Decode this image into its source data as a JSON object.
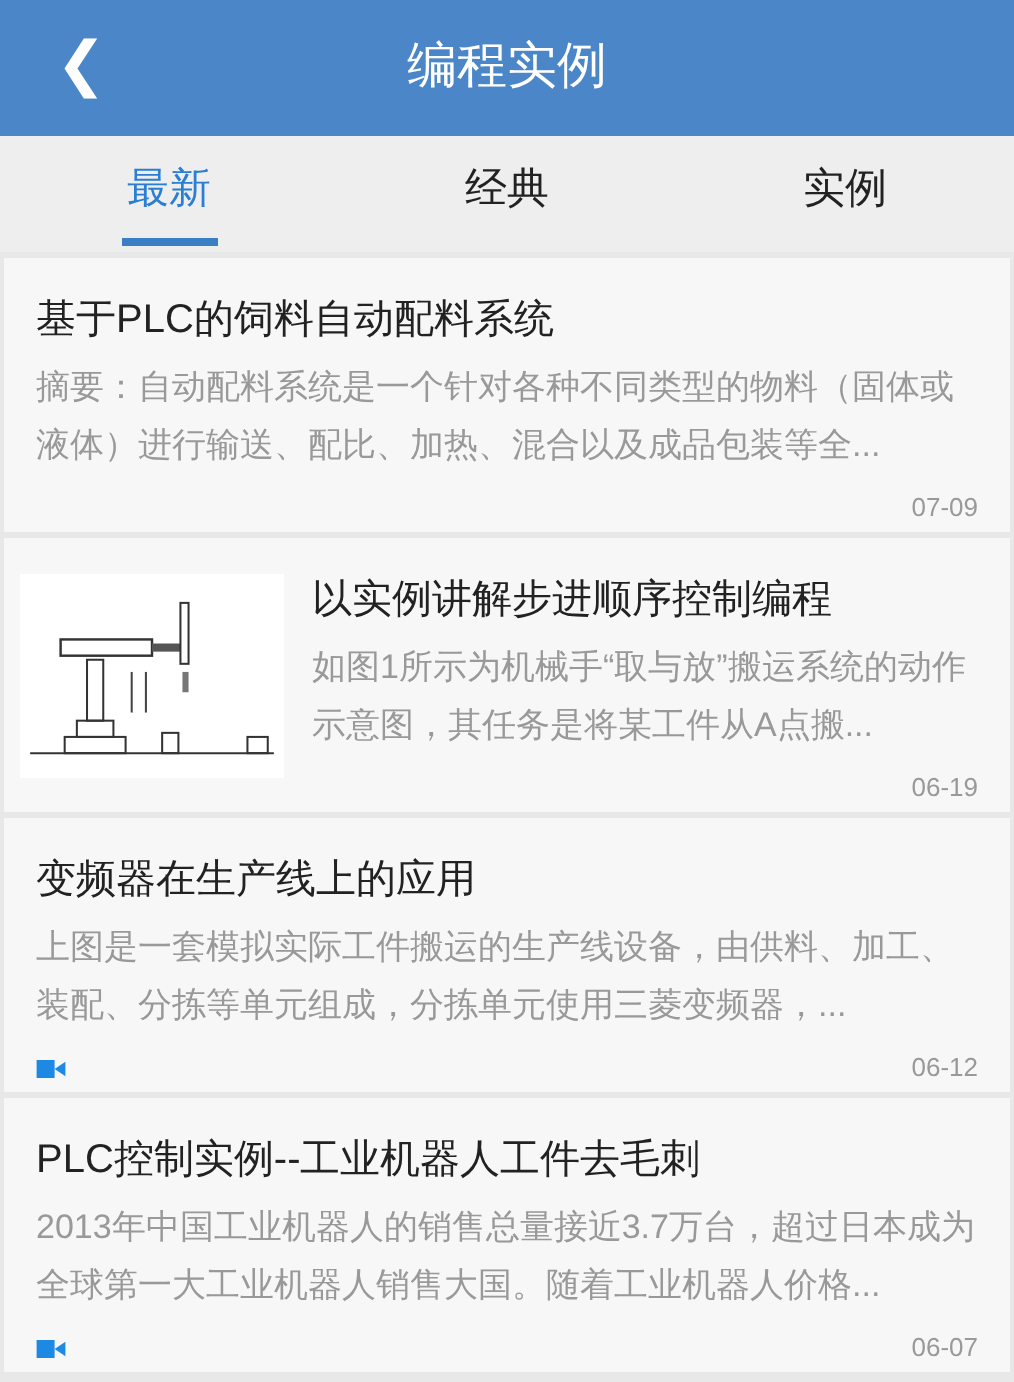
{
  "header": {
    "back": "❮",
    "title": "编程实例"
  },
  "tabs": [
    {
      "label": "最新",
      "selected": true
    },
    {
      "label": "经典",
      "selected": false
    },
    {
      "label": "实例",
      "selected": false
    }
  ],
  "articles": [
    {
      "title": "基于PLC的饲料自动配料系统",
      "summary": "摘要：自动配料系统是一个针对各种不同类型的物料（固体或液体）进行输送、配比、加热、混合以及成品包装等全...",
      "date": "07-09",
      "thumbnail": false,
      "video": false
    },
    {
      "title": "以实例讲解步进顺序控制编程",
      "summary": "如图1所示为机械手“取与放”搬运系统的动作示意图，其任务是将某工件从A点搬...",
      "date": "06-19",
      "thumbnail": true,
      "video": false
    },
    {
      "title": "变频器在生产线上的应用",
      "summary": "上图是一套模拟实际工件搬运的生产线设备，由供料、加工、装配、分拣等单元组成，分拣单元使用三菱变频器，...",
      "date": "06-12",
      "thumbnail": false,
      "video": true
    },
    {
      "title": "PLC控制实例--工业机器人工件去毛刺",
      "summary": "2013年中国工业机器人的销售总量接近3.7万台，超过日本成为全球第一大工业机器人销售大国。随着工业机器人价格...",
      "date": "06-07",
      "thumbnail": false,
      "video": true
    }
  ]
}
